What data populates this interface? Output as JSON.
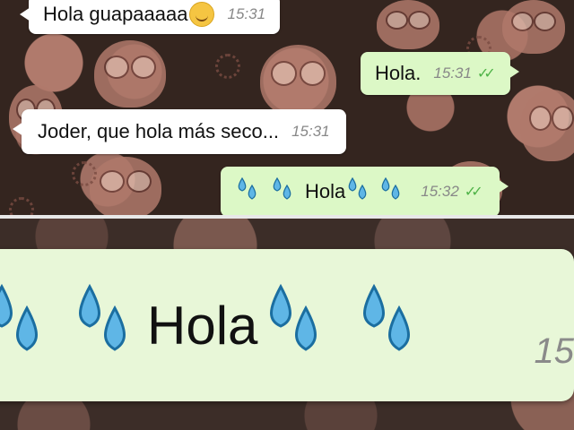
{
  "messages": [
    {
      "text": "Hola guapaaaaa",
      "time": "15:31",
      "direction": "incoming",
      "emoji": "smiling-face-icon"
    },
    {
      "text": "Hola.",
      "time": "15:31",
      "direction": "outgoing",
      "status": "read"
    },
    {
      "text": "Joder, que hola más seco...",
      "time": "15:31",
      "direction": "incoming"
    },
    {
      "text": "Hola",
      "time": "15:32",
      "direction": "outgoing",
      "status": "read",
      "emoji": "sweat-droplets-icon"
    }
  ],
  "zoom": {
    "text": "Hola",
    "time": "15",
    "emoji": "sweat-droplets-icon"
  },
  "colors": {
    "incoming_bubble": "#ffffff",
    "outgoing_bubble": "#dcf8c6",
    "read_ticks": "#4fb348",
    "wallpaper": "#34251f"
  }
}
